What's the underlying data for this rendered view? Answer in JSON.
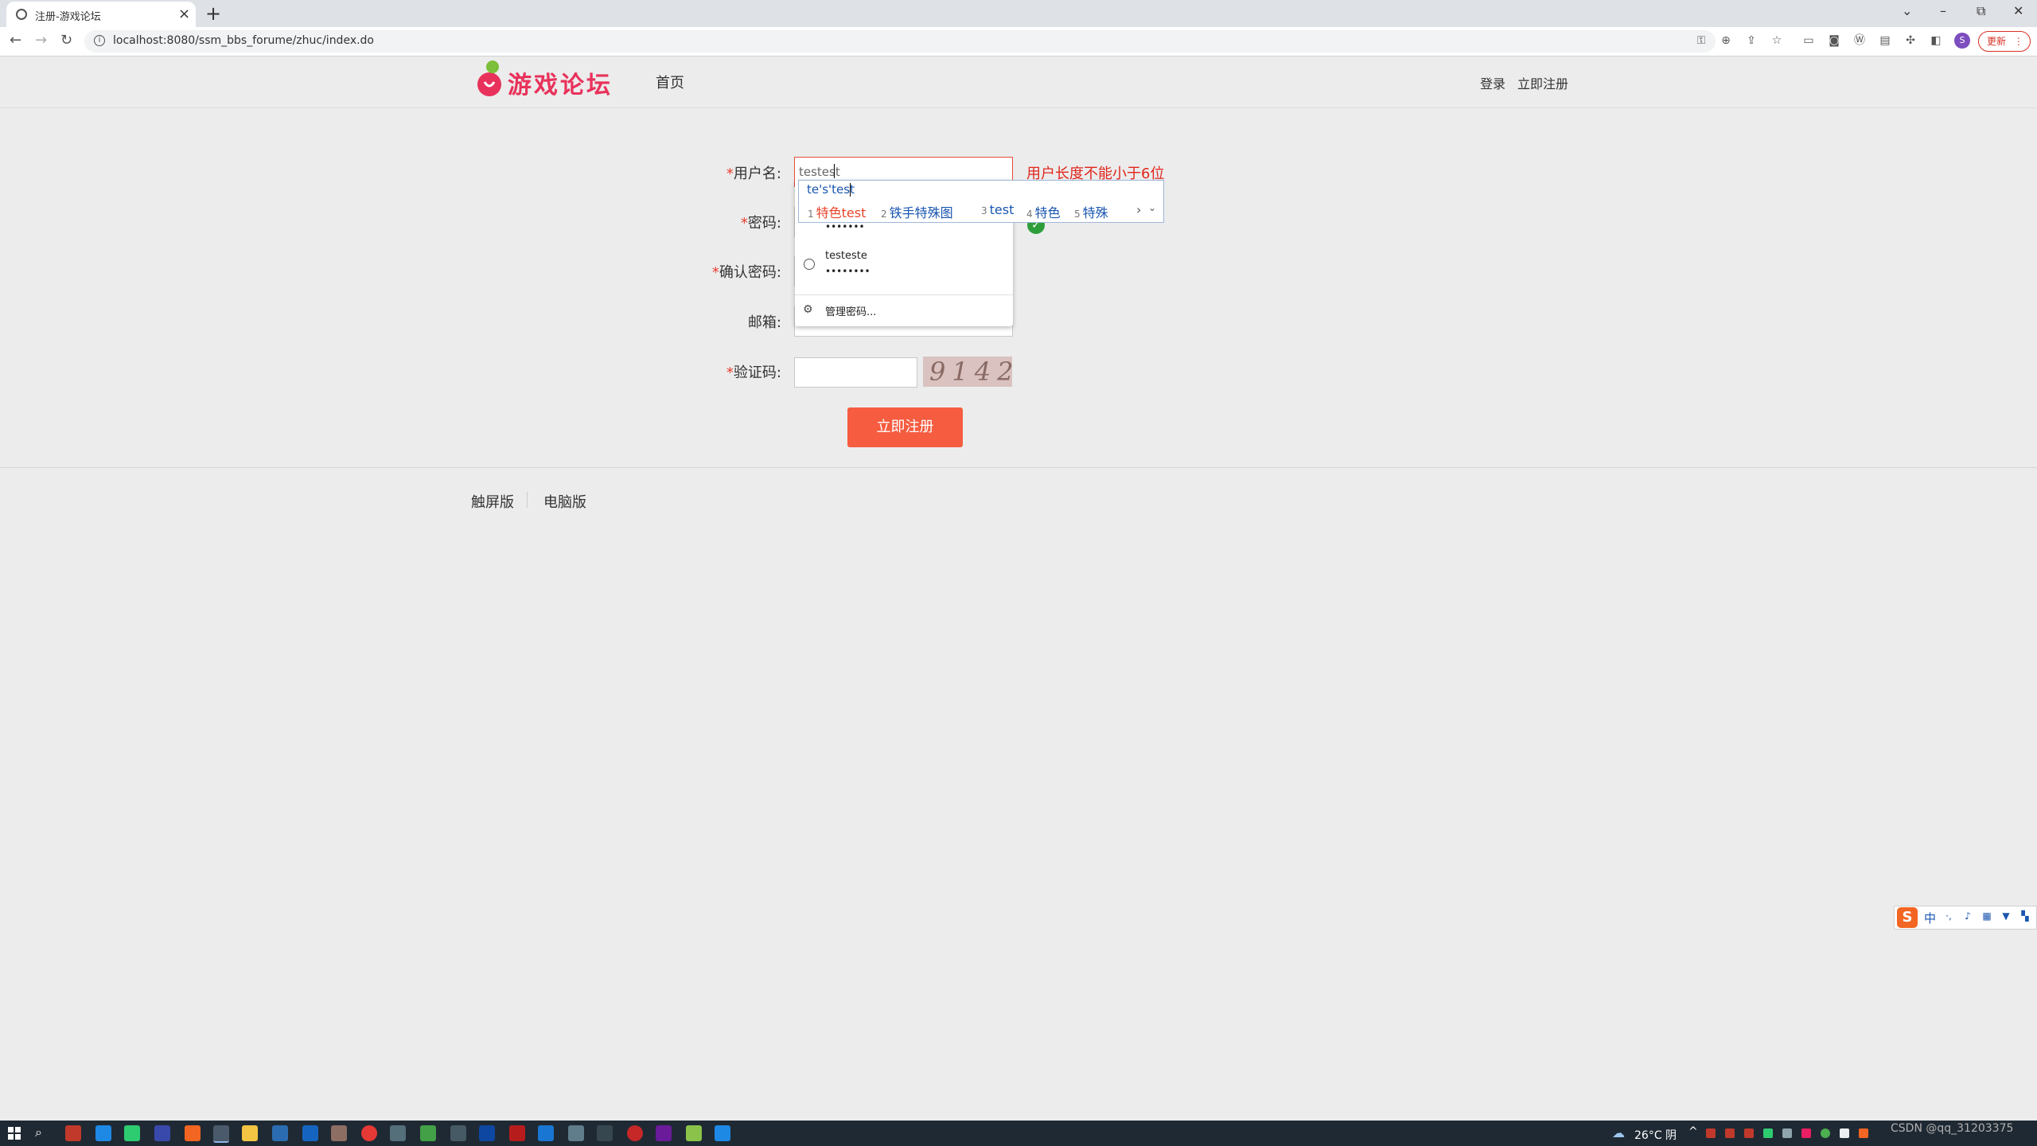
{
  "browser": {
    "tab_title": "注册-游戏论坛",
    "tab_close": "×",
    "new_tab": "+",
    "url": "localhost:8080/ssm_bbs_forume/zhuc/index.do",
    "update_label": "更新",
    "profile_initial": "S",
    "window_controls": {
      "list": "⌄",
      "minimize": "–",
      "restore": "⧉",
      "close": "✕"
    }
  },
  "site": {
    "logo_text": "游戏论坛",
    "nav_home": "首页",
    "nav_login": "登录",
    "nav_register": "立即注册"
  },
  "form": {
    "required_mark": "*",
    "username_label": "用户名:",
    "username_value": "testest",
    "username_error": "用户长度不能小于6位",
    "password_label": "密码:",
    "confirm_label": "确认密码:",
    "email_label": "邮箱:",
    "captcha_label": "验证码:",
    "captcha_text": "9142",
    "submit_label": "立即注册"
  },
  "password_dropdown": {
    "saved_password_dots_1": "•••••••",
    "saved_user": "testeste",
    "saved_password_dots_2": "••••••••",
    "manage_label": "管理密码..."
  },
  "ime": {
    "composition": "te's'test",
    "candidates": [
      {
        "num": "1",
        "text": "特色test"
      },
      {
        "num": "2",
        "text": "铁手特殊图"
      },
      {
        "num": "3",
        "text": "test"
      },
      {
        "num": "4",
        "text": "特色"
      },
      {
        "num": "5",
        "text": "特殊"
      }
    ],
    "next": "›",
    "expand": "⌄"
  },
  "footer": {
    "touch_label": "触屏版",
    "pc_label": "电脑版"
  },
  "sogou_bar": {
    "logo": "S",
    "mode": "中"
  },
  "taskbar": {
    "weather_icon": "cloud-icon",
    "temperature": "26°C 阴",
    "csdn_text": "CSDN @qq_31203375"
  },
  "colors": {
    "accent": "#f55c40",
    "error": "#e0261c",
    "logo": "#e8325b",
    "ime_blue": "#1a56b0"
  }
}
